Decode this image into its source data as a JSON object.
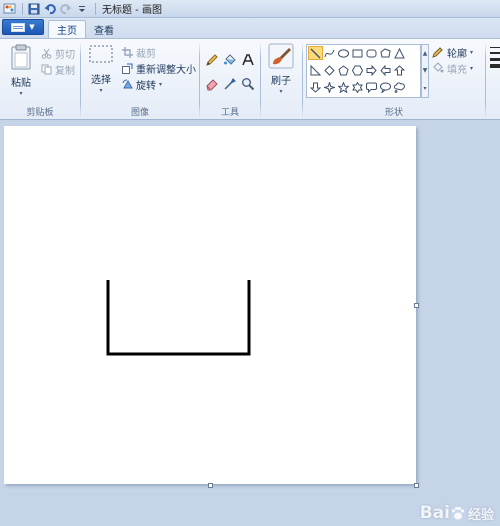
{
  "title_bar": {
    "title": "无标题 - 画图"
  },
  "tabs": {
    "home": "主页",
    "view": "查看"
  },
  "clipboard": {
    "paste": "粘贴",
    "cut": "剪切",
    "copy": "复制",
    "group_label": "剪贴板"
  },
  "image": {
    "select": "选择",
    "crop": "裁剪",
    "resize": "重新调整大小",
    "rotate": "旋转",
    "group_label": "图像"
  },
  "tools": {
    "group_label": "工具"
  },
  "brushes": {
    "label": "刷子"
  },
  "shapes": {
    "outline": "轮廓",
    "fill": "填充",
    "group_label": "形状"
  },
  "watermark": {
    "text": "Bai",
    "suffix": "经验"
  },
  "colors": {
    "accent": "#1c57b4",
    "ribbon": "#e4ecf7",
    "workspace": "#c6d4e8",
    "canvas": "#ffffff",
    "selected_shape": "#fcd97b"
  }
}
